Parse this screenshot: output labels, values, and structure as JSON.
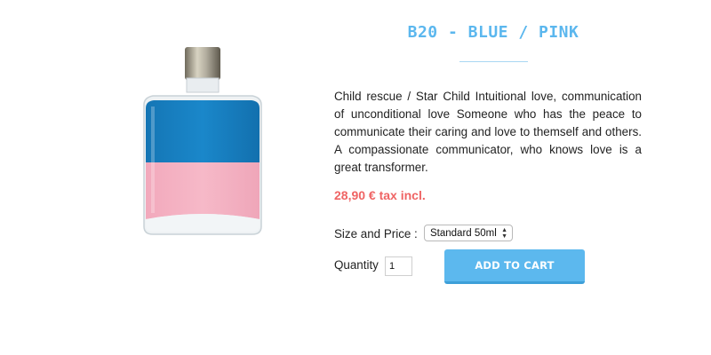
{
  "product": {
    "title": "B20 - BLUE / PINK",
    "description": "Child rescue / Star Child Intuitional love, communication of unconditional love Someone who has the peace to communicate their caring and love to themself and others. A compassionate communicator, who knows love is a great transformer.",
    "price": "28,90 € tax incl.",
    "image_icon": "bottle-image",
    "colors": {
      "top": "#1a86c8",
      "bottom": "#f5b5c6",
      "accent": "#5bb7ee",
      "price": "#ef6464"
    }
  },
  "options": {
    "size_label": "Size and Price :",
    "size_selected": "Standard 50ml"
  },
  "quantity": {
    "label": "Quantity",
    "value": "1"
  },
  "cart": {
    "button_label": "ADD TO CART"
  }
}
